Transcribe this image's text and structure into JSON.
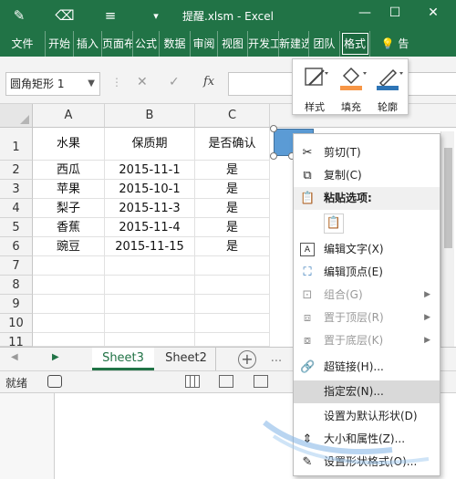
{
  "window": {
    "title": "提醒.xlsm - Excel",
    "qat_icons": [
      "paintbrush-icon",
      "eraser-icon",
      "menu-icon",
      "expand-icon"
    ],
    "controls": [
      "—",
      "☐",
      "✕"
    ]
  },
  "ribbon": {
    "tabs": [
      "文件",
      "开始",
      "插入",
      "页面布局",
      "公式",
      "数据",
      "审阅",
      "视图",
      "开发工具",
      "新建选项卡",
      "团队",
      "格式",
      "告"
    ],
    "active_tab": "格式",
    "tell_icon": "lightbulb-icon"
  },
  "formula_bar": {
    "name_box": "圆角矩形 1",
    "cancel": "✕",
    "enter": "✓",
    "fx": "fx",
    "formula": ""
  },
  "mini_toolbar": {
    "items": [
      "样式",
      "填充",
      "轮廓"
    ],
    "fill_color": "#f79646",
    "outline_color": "#2e75b6"
  },
  "grid": {
    "columns": [
      "A",
      "B",
      "C"
    ],
    "rows": [
      "1",
      "2",
      "3",
      "4",
      "5",
      "6",
      "7",
      "8",
      "9",
      "10",
      "11"
    ],
    "cells": [
      [
        "水果",
        "保质期",
        "是否确认"
      ],
      [
        "西瓜",
        "2015-11-1",
        "是"
      ],
      [
        "苹果",
        "2015-10-1",
        "是"
      ],
      [
        "梨子",
        "2015-11-3",
        "是"
      ],
      [
        "香蕉",
        "2015-11-4",
        "是"
      ],
      [
        "豌豆",
        "2015-11-15",
        "是"
      ]
    ],
    "shape_color": "#5b9bd5"
  },
  "sheets": {
    "tabs": [
      "Sheet3",
      "Sheet2"
    ],
    "active": "Sheet3",
    "ellipsis": "..."
  },
  "status": {
    "text": "就绪"
  },
  "context_menu": {
    "items": [
      {
        "label": "剪切(T)",
        "icon": "scissors-icon",
        "enabled": true
      },
      {
        "label": "复制(C)",
        "icon": "copy-icon",
        "enabled": true
      },
      {
        "label": "粘贴选项:",
        "icon": "paste-icon",
        "enabled": true,
        "header": true
      },
      {
        "label": "编辑文字(X)",
        "icon": "text-edit-icon",
        "enabled": true
      },
      {
        "label": "编辑顶点(E)",
        "icon": "edit-points-icon",
        "enabled": true
      },
      {
        "label": "组合(G)",
        "icon": "group-icon",
        "enabled": false,
        "submenu": true
      },
      {
        "label": "置于顶层(R)",
        "icon": "bring-front-icon",
        "enabled": false,
        "submenu": true
      },
      {
        "label": "置于底层(K)",
        "icon": "send-back-icon",
        "enabled": false,
        "submenu": true
      },
      {
        "label": "超链接(H)...",
        "icon": "hyperlink-icon",
        "enabled": true
      },
      {
        "label": "指定宏(N)...",
        "icon": "",
        "enabled": true,
        "hover": true
      },
      {
        "label": "设置为默认形状(D)",
        "icon": "",
        "enabled": true
      },
      {
        "label": "大小和属性(Z)...",
        "icon": "size-icon",
        "enabled": true
      },
      {
        "label": "设置形状格式(O)...",
        "icon": "format-shape-icon",
        "enabled": true
      }
    ]
  }
}
